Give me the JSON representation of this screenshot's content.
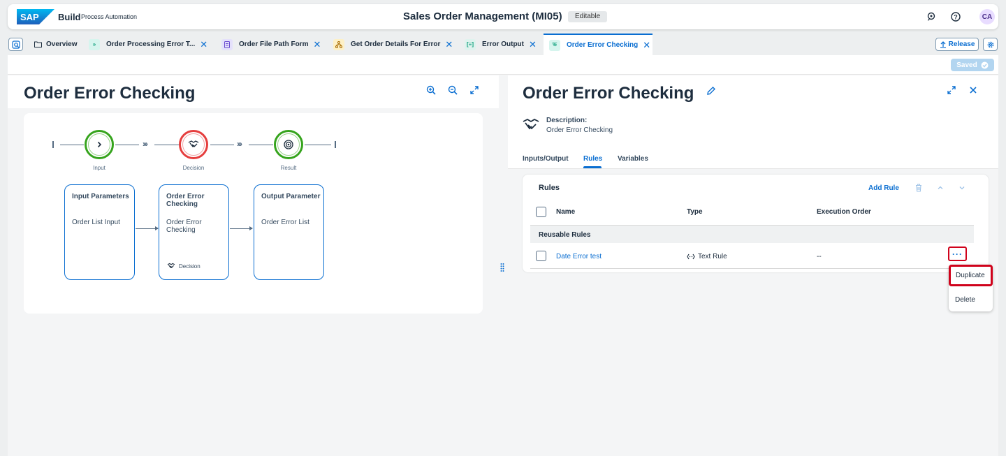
{
  "shell": {
    "brand": "SAP",
    "product": "Build",
    "subtitle": "Process Automation",
    "project_title": "Sales Order Management (MI05)",
    "status_badge": "Editable",
    "avatar_initials": "CA"
  },
  "tabs": [
    {
      "label": "Overview",
      "icon": "folder-icon"
    },
    {
      "label": "Order Processing Error T...",
      "icon": "process-icon"
    },
    {
      "label": "Order File Path Form",
      "icon": "form-icon"
    },
    {
      "label": "Get Order Details For Error",
      "icon": "automation-icon"
    },
    {
      "label": "Error Output",
      "icon": "output-icon"
    },
    {
      "label": "Order Error Checking",
      "icon": "decision-icon",
      "active": true
    }
  ],
  "toolbar": {
    "release_label": "Release",
    "saved_label": "Saved"
  },
  "left": {
    "title": "Order Error Checking",
    "flow": {
      "steps": [
        {
          "label": "Input",
          "color": "#36a41d"
        },
        {
          "label": "Decision",
          "color": "#e53e3e"
        },
        {
          "label": "Result",
          "color": "#36a41d"
        }
      ],
      "boxes": [
        {
          "title": "Input Parameters",
          "text": "Order List Input"
        },
        {
          "title": "Order Error Checking",
          "text": "Order Error Checking",
          "footer": "Decision"
        },
        {
          "title": "Output Parameter",
          "text": "Order Error List"
        }
      ]
    }
  },
  "right": {
    "title": "Order Error Checking",
    "description_label": "Description:",
    "description_value": "Order Error Checking",
    "tabs": [
      "Inputs/Output",
      "Rules",
      "Variables"
    ],
    "active_tab": "Rules",
    "rules": {
      "heading": "Rules",
      "add_label": "Add Rule",
      "columns": [
        "Name",
        "Type",
        "Execution Order"
      ],
      "group_label": "Reusable Rules",
      "rows": [
        {
          "name": "Date Error test",
          "type": "Text Rule",
          "order": "--"
        }
      ]
    },
    "menu": [
      "Duplicate",
      "Delete"
    ]
  }
}
